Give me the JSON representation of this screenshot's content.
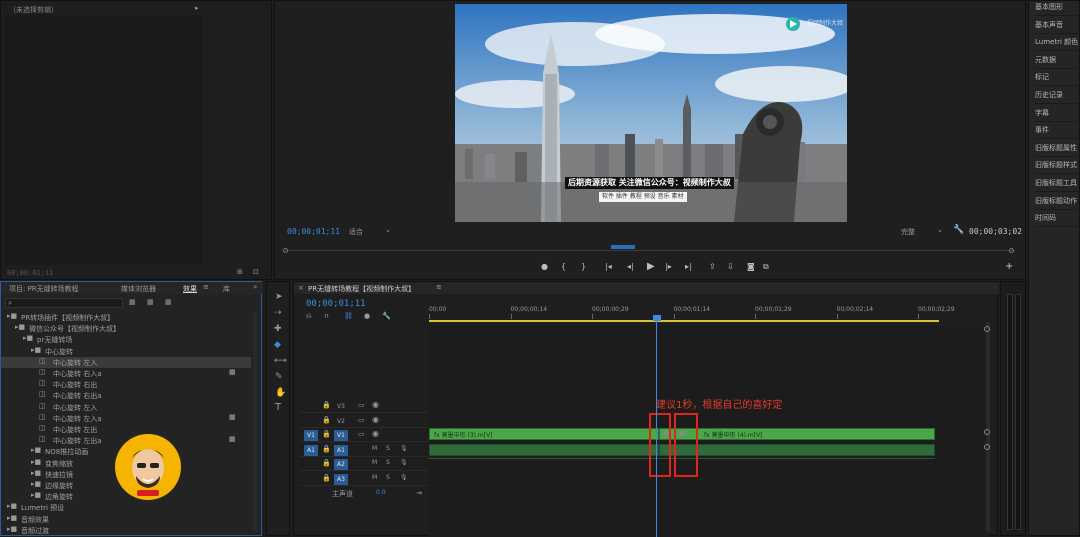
{
  "source_panel": {
    "title": "（未选择剪辑）",
    "footer_time": "00;00;01;11"
  },
  "program": {
    "current_time": "00;00;01;11",
    "fit": "适合",
    "quality": "完整",
    "duration": "00;00;03;02",
    "video_text": {
      "logo": "视频制作大叔",
      "title": "后期资源获取 关注微信公众号：视频制作大叔",
      "subtitle": "软件 插件 教程 预设 音乐 素材"
    }
  },
  "right_panel": {
    "items": [
      "基本图形",
      "基本声音",
      "Lumetri 颜色",
      "元数据",
      "标记",
      "历史记录",
      "字幕",
      "事件",
      "旧版标题属性",
      "旧版标题样式",
      "旧版标题工具",
      "旧版标题动作",
      "时间码"
    ]
  },
  "project_panel": {
    "tabs": [
      "项目: PR无缝转场教程",
      "媒体浏览器",
      "效果",
      "库"
    ],
    "tree": [
      {
        "label": "PR转场插件【视频制作大叔】",
        "level": 1
      },
      {
        "label": "微信公众号【视频制作大叔】",
        "level": 2
      },
      {
        "label": "pr无缝转场",
        "level": 3
      },
      {
        "label": "中心旋转",
        "level": 4
      },
      {
        "label": "中心旋转 左入",
        "level": 5,
        "selected": true
      },
      {
        "label": "中心旋转 右入a",
        "level": 5,
        "badge": true
      },
      {
        "label": "中心旋转 右出",
        "level": 5
      },
      {
        "label": "中心旋转 右出a",
        "level": 5
      },
      {
        "label": "中心旋转 左入",
        "level": 5
      },
      {
        "label": "中心旋转 左入a",
        "level": 5,
        "badge": true
      },
      {
        "label": "中心旋转 左出",
        "level": 5
      },
      {
        "label": "中心旋转 左出a",
        "level": 5,
        "badge": true
      },
      {
        "label": "NO8推拉动画",
        "level": 4
      },
      {
        "label": "变焦缩放",
        "level": 4
      },
      {
        "label": "快速拉镜",
        "level": 4
      },
      {
        "label": "边缘旋转",
        "level": 4
      },
      {
        "label": "边角旋转",
        "level": 4
      },
      {
        "label": "Lumetri 预设",
        "level": 1
      },
      {
        "label": "音频效果",
        "level": 1
      },
      {
        "label": "音频过渡",
        "level": 1
      }
    ]
  },
  "timeline": {
    "sequence_tab": "PR无缝转场教程【视频制作大叔】",
    "current_time": "00;00;01;11",
    "ruler": [
      "00;00",
      "00;00;00;14",
      "00;00;00;29",
      "00;00;01;14",
      "00;00;01;29",
      "00;00;02;14",
      "00;00;02;29"
    ],
    "tracks": [
      {
        "name": "V3",
        "kind": "video"
      },
      {
        "name": "V2",
        "kind": "video"
      },
      {
        "name": "V1",
        "kind": "video",
        "src": "V1"
      },
      {
        "name": "A1",
        "kind": "audio",
        "src": "A1"
      },
      {
        "name": "A2",
        "kind": "audio"
      },
      {
        "name": "A3",
        "kind": "audio"
      }
    ],
    "master": {
      "label": "主声道",
      "value": "0.0"
    },
    "clip_left_label": "fx 莫墨中形 (3).m[V]",
    "clip_right_label": "fx 莫墨中形 (4).m[V]",
    "annotation": "建议1秒，根据自己的喜好定"
  }
}
